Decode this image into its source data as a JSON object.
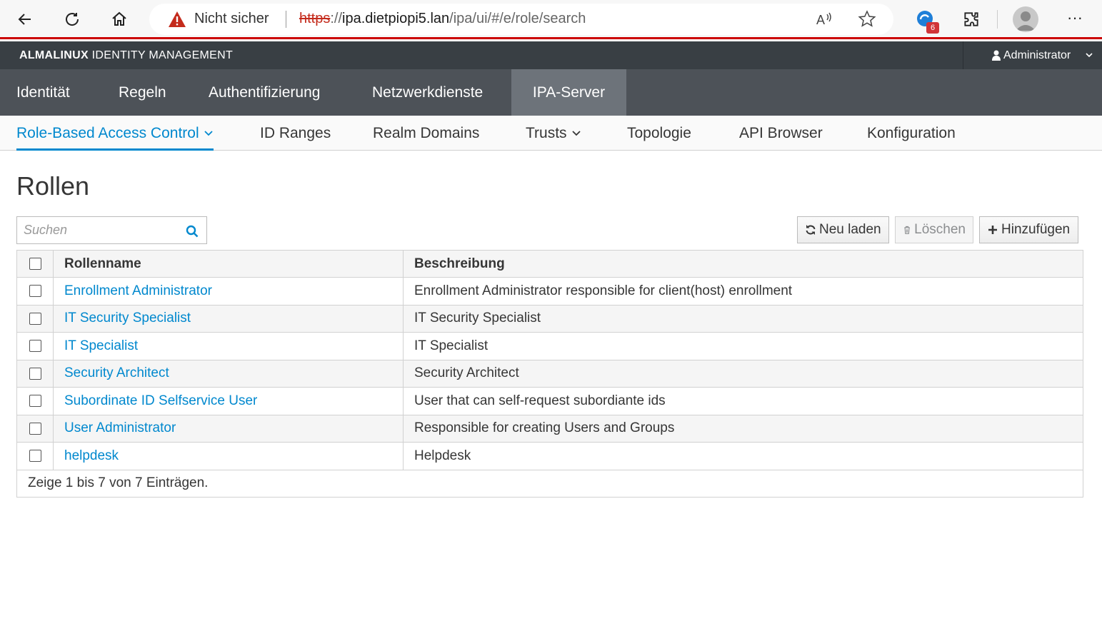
{
  "browser": {
    "security_warning": "Nicht sicher",
    "url_scheme": "https",
    "url_sep": "://",
    "url_host": "ipa.dietpiopi5.lan",
    "url_path": "/ipa/ui/#/e/role/search",
    "extension_badge": "6"
  },
  "header": {
    "brand_bold": "ALMALINUX",
    "brand_rest": " IDENTITY MANAGEMENT",
    "user": "Administrator"
  },
  "main_nav": [
    {
      "label": "Identität"
    },
    {
      "label": "Regeln"
    },
    {
      "label": "Authentifizierung"
    },
    {
      "label": "Netzwerkdienste"
    },
    {
      "label": "IPA-Server",
      "active": true
    }
  ],
  "sub_nav": [
    {
      "label": "Role-Based Access Control",
      "active": true
    },
    {
      "label": "ID Ranges"
    },
    {
      "label": "Realm Domains"
    },
    {
      "label": "Trusts"
    },
    {
      "label": "Topologie"
    },
    {
      "label": "API Browser"
    },
    {
      "label": "Konfiguration"
    }
  ],
  "page": {
    "title": "Rollen",
    "search_placeholder": "Suchen",
    "reload_label": "Neu laden",
    "delete_label": "Löschen",
    "add_label": "Hinzufügen"
  },
  "table": {
    "col_name": "Rollenname",
    "col_desc": "Beschreibung",
    "rows": [
      {
        "name": "Enrollment Administrator",
        "description": "Enrollment Administrator responsible for client(host) enrollment"
      },
      {
        "name": "IT Security Specialist",
        "description": "IT Security Specialist"
      },
      {
        "name": "IT Specialist",
        "description": "IT Specialist"
      },
      {
        "name": "Security Architect",
        "description": "Security Architect"
      },
      {
        "name": "Subordinate ID Selfservice User",
        "description": "User that can self-request subordiante ids"
      },
      {
        "name": "User Administrator",
        "description": "Responsible for creating Users and Groups"
      },
      {
        "name": "helpdesk",
        "description": "Helpdesk"
      }
    ],
    "footer": "Zeige 1 bis 7 von 7 Einträgen."
  },
  "colors": {
    "accent": "#0088ce",
    "brandbar": "#393f44",
    "mainnav": "#4d5258",
    "mainnav_active": "#6d737a",
    "warning": "#cc0000"
  }
}
